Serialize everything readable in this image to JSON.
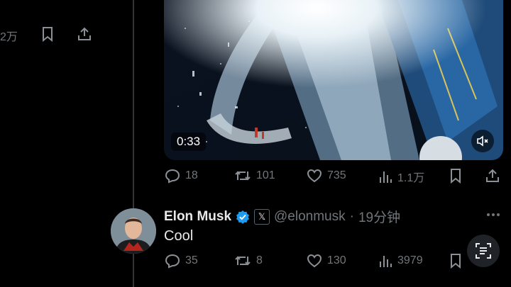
{
  "top_row": {
    "views": "2万"
  },
  "video": {
    "duration": "0:33"
  },
  "post1_actions": {
    "replies": "18",
    "reposts": "101",
    "likes": "735",
    "views": "1.1万"
  },
  "reply": {
    "author_name": "Elon Musk",
    "handle": "@elonmusk",
    "separator": "·",
    "time": "19分钟",
    "text": "Cool",
    "badge_letter": "𝕏"
  },
  "reply_actions": {
    "replies": "35",
    "reposts": "8",
    "likes": "130",
    "views": "3979"
  },
  "colors": {
    "background": "#000000",
    "verified": "#1d9bf0",
    "muted_text": "#71767b"
  },
  "icons": [
    "bookmark-icon",
    "share-icon",
    "reply-icon",
    "repost-icon",
    "like-icon",
    "views-icon",
    "mute-icon",
    "more-icon",
    "text-scan-icon"
  ]
}
